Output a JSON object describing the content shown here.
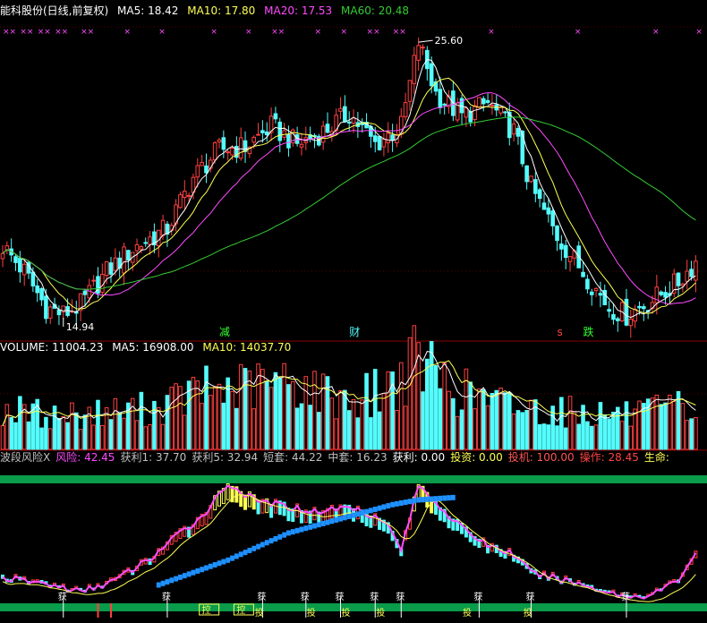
{
  "main_header": {
    "stock": "能科股份(日线,前复权)",
    "items": [
      {
        "label": "MA5: 18.42",
        "color": "#ffffff"
      },
      {
        "label": "MA10: 17.80",
        "color": "#ffff54"
      },
      {
        "label": "MA20: 17.53",
        "color": "#ff4cff"
      },
      {
        "label": "MA60: 20.48",
        "color": "#33cc33"
      }
    ]
  },
  "vol_header": {
    "items": [
      {
        "label": "VOLUME: 11004.23",
        "color": "#ffffff"
      },
      {
        "label": "MA5: 16908.00",
        "color": "#ffffff"
      },
      {
        "label": "MA10: 14037.70",
        "color": "#ffff54"
      }
    ]
  },
  "ind_header": {
    "items": [
      {
        "label": "波段风险X",
        "color": "#c0c0c0"
      },
      {
        "label": "风险: 42.45",
        "color": "#ff4cff"
      },
      {
        "label": "获利1: 37.70",
        "color": "#c0c0c0"
      },
      {
        "label": "获利5: 32.94",
        "color": "#c0c0c0"
      },
      {
        "label": "短套: 44.22",
        "color": "#c0c0c0"
      },
      {
        "label": "中套: 16.23",
        "color": "#c0c0c0"
      },
      {
        "label": "获利: 0.00",
        "color": "#ffffff"
      },
      {
        "label": "投资: 0.00",
        "color": "#ffff54"
      },
      {
        "label": "投机: 100.00",
        "color": "#ff5555"
      },
      {
        "label": "操作: 28.45",
        "color": "#ff4444"
      },
      {
        "label": "生命:",
        "color": "#ffff54"
      }
    ]
  },
  "markers": {
    "high": "25.60",
    "low": "14.94",
    "jian": "减",
    "cai": "财",
    "s": "s",
    "die": "跌",
    "huo": "获",
    "tou": "投",
    "kong": "控",
    "xx": "××",
    "x": "×",
    "alarm": "▲"
  },
  "chart_data": [
    {
      "type": "candlestick",
      "series": [
        {
          "name": "MA5",
          "color": "#ffffff"
        },
        {
          "name": "MA10",
          "color": "#ffff54"
        },
        {
          "name": "MA20",
          "color": "#ff4cff"
        },
        {
          "name": "MA60",
          "color": "#33cc33"
        }
      ],
      "annotations": [
        "25.60",
        "14.94"
      ],
      "trend_points": [
        [
          0,
          17.6
        ],
        [
          5,
          16.6
        ],
        [
          10,
          15.2
        ],
        [
          14,
          14.94
        ],
        [
          18,
          15.3
        ],
        [
          24,
          16.6
        ],
        [
          30,
          17.5
        ],
        [
          38,
          18.3
        ],
        [
          44,
          20.3
        ],
        [
          50,
          21.4
        ],
        [
          56,
          21.5
        ],
        [
          62,
          22.3
        ],
        [
          68,
          21.6
        ],
        [
          74,
          22.1
        ],
        [
          80,
          22.8
        ],
        [
          86,
          21.6
        ],
        [
          92,
          22.3
        ],
        [
          96,
          25.6
        ],
        [
          100,
          23.6
        ],
        [
          106,
          22.7
        ],
        [
          112,
          23.2
        ],
        [
          118,
          22.1
        ],
        [
          122,
          19.9
        ],
        [
          128,
          18.0
        ],
        [
          134,
          16.6
        ],
        [
          140,
          15.2
        ],
        [
          144,
          14.9
        ],
        [
          150,
          15.5
        ],
        [
          156,
          16.2
        ],
        [
          160,
          17.0
        ]
      ],
      "ylim": [
        14.2,
        26.2
      ]
    },
    {
      "type": "bar",
      "series": [
        {
          "name": "VOLUME",
          "color": "#ffffff"
        },
        {
          "name": "MA5",
          "color": "#ffffff"
        },
        {
          "name": "MA10",
          "color": "#ffff54"
        }
      ],
      "trend_points": [
        [
          0,
          12500
        ],
        [
          12,
          10500
        ],
        [
          24,
          11500
        ],
        [
          36,
          13000
        ],
        [
          46,
          18500
        ],
        [
          54,
          19000
        ],
        [
          60,
          20000
        ],
        [
          68,
          21000
        ],
        [
          74,
          17500
        ],
        [
          82,
          15500
        ],
        [
          90,
          20500
        ],
        [
          96,
          28000
        ],
        [
          104,
          19000
        ],
        [
          114,
          14500
        ],
        [
          124,
          12500
        ],
        [
          136,
          11500
        ],
        [
          146,
          10500
        ],
        [
          156,
          13000
        ],
        [
          160,
          11004
        ]
      ],
      "ylim": [
        0,
        30000
      ]
    },
    {
      "type": "line",
      "series": [
        {
          "name": "风险",
          "color": "#ff4cff"
        },
        {
          "name": "获利",
          "color": "#ffffff"
        },
        {
          "name": "投资",
          "color": "#ffff54"
        },
        {
          "name": "投机",
          "color": "#ff5555"
        },
        {
          "name": "操作",
          "color": "#ff4444"
        },
        {
          "name": "生命",
          "color": "#1e90ff"
        }
      ],
      "risk_points": [
        [
          0,
          20
        ],
        [
          10,
          15
        ],
        [
          18,
          8
        ],
        [
          26,
          18
        ],
        [
          34,
          36
        ],
        [
          40,
          55
        ],
        [
          46,
          72
        ],
        [
          52,
          100
        ],
        [
          58,
          86
        ],
        [
          66,
          80
        ],
        [
          72,
          76
        ],
        [
          80,
          80
        ],
        [
          88,
          70
        ],
        [
          92,
          44
        ],
        [
          96,
          98
        ],
        [
          100,
          84
        ],
        [
          106,
          62
        ],
        [
          112,
          48
        ],
        [
          118,
          40
        ],
        [
          122,
          24
        ],
        [
          130,
          18
        ],
        [
          138,
          10
        ],
        [
          144,
          4
        ],
        [
          150,
          6
        ],
        [
          156,
          18
        ],
        [
          160,
          42
        ]
      ],
      "life_points": [
        [
          36,
          14
        ],
        [
          52,
          35
        ],
        [
          66,
          58
        ],
        [
          80,
          72
        ],
        [
          90,
          82
        ],
        [
          96,
          86
        ],
        [
          104,
          88
        ]
      ],
      "ylim": [
        0,
        100
      ]
    }
  ]
}
